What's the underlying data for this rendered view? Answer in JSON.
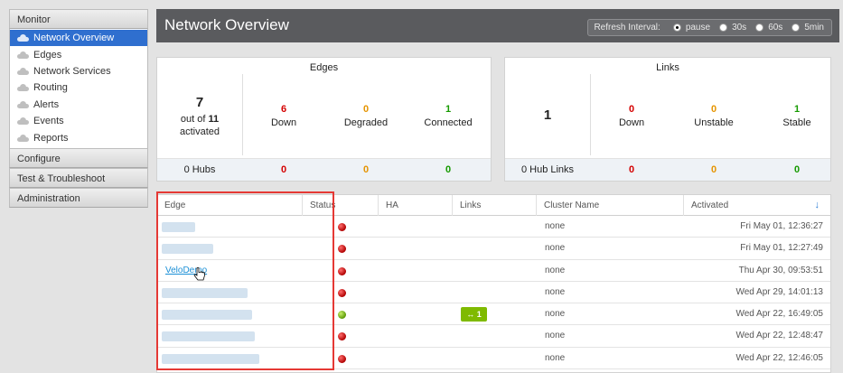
{
  "sidebar": {
    "monitor_label": "Monitor",
    "items": [
      {
        "label": "Network Overview",
        "active": true
      },
      {
        "label": "Edges"
      },
      {
        "label": "Network Services"
      },
      {
        "label": "Routing"
      },
      {
        "label": "Alerts"
      },
      {
        "label": "Events"
      },
      {
        "label": "Reports"
      }
    ],
    "configure_label": "Configure",
    "test_label": "Test & Troubleshoot",
    "admin_label": "Administration"
  },
  "header": {
    "title": "Network Overview",
    "refresh_label": "Refresh Interval:",
    "refresh_options": [
      "pause",
      "30s",
      "60s",
      "5min"
    ],
    "refresh_selected": "pause"
  },
  "edges_card": {
    "title": "Edges",
    "activated_count": "7",
    "out_of_prefix": "out of",
    "total": "11",
    "activated_label": "activated",
    "down_count": "6",
    "down_label": "Down",
    "degraded_count": "0",
    "degraded_label": "Degraded",
    "connected_count": "1",
    "connected_label": "Connected",
    "hubs_label": "0 Hubs",
    "hubs_down": "0",
    "hubs_degraded": "0",
    "hubs_connected": "0"
  },
  "links_card": {
    "title": "Links",
    "total": "1",
    "down_count": "0",
    "down_label": "Down",
    "unstable_count": "0",
    "unstable_label": "Unstable",
    "stable_count": "1",
    "stable_label": "Stable",
    "hub_links_label": "0 Hub Links",
    "hub_down": "0",
    "hub_unstable": "0",
    "hub_stable": "0"
  },
  "table": {
    "columns": [
      "Edge",
      "Status",
      "HA",
      "Links",
      "Cluster Name",
      "Activated"
    ],
    "sort_icon": "sort-down-arrow-icon",
    "rows": [
      {
        "edge": "",
        "status": "down",
        "links": "",
        "cluster": "none",
        "activated": "Fri May 01, 12:36:27"
      },
      {
        "edge": "",
        "status": "down",
        "links": "",
        "cluster": "none",
        "activated": "Fri May 01, 12:27:49"
      },
      {
        "edge": "VeloDemo",
        "status": "down",
        "links": "",
        "cluster": "none",
        "activated": "Thu Apr 30, 09:53:51"
      },
      {
        "edge": "",
        "status": "down",
        "links": "",
        "cluster": "none",
        "activated": "Wed Apr 29, 14:01:13"
      },
      {
        "edge": "",
        "status": "up",
        "links": "1",
        "cluster": "none",
        "activated": "Wed Apr 22, 16:49:05"
      },
      {
        "edge": "",
        "status": "down",
        "links": "",
        "cluster": "none",
        "activated": "Wed Apr 22, 12:48:47"
      },
      {
        "edge": "",
        "status": "down",
        "links": "",
        "cluster": "none",
        "activated": "Wed Apr 22, 12:46:05"
      }
    ]
  },
  "colors": {
    "down": "#d40000",
    "degraded": "#e59400",
    "connected": "#169a00",
    "header_bg": "#5a5b5e",
    "active_nav": "#2f6fcf",
    "link_badge": "#7fba00"
  }
}
